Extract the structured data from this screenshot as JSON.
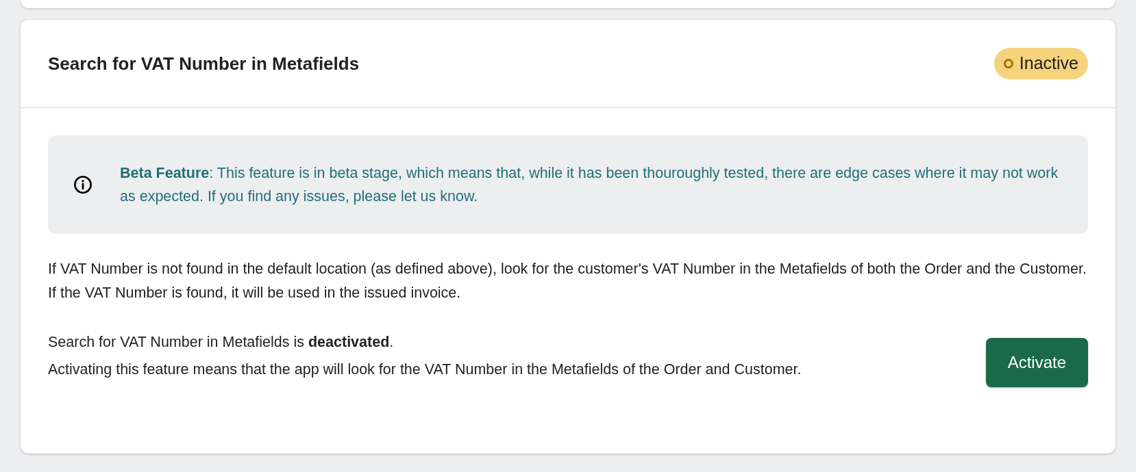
{
  "card": {
    "title": "Search for VAT Number in Metafields",
    "status": {
      "label": "Inactive",
      "kind": "inactive"
    },
    "banner": {
      "text": "**Beta Feature**: This feature is in beta stage, which means that, while it has been thouroughly tested, there are edge cases where it may not work as expected. If you find any issues, please let us know."
    },
    "description": "If VAT Number is not found in the default location (as defined above), look for the customer's VAT Number in the Metafields of both the Order and the Customer. If the VAT Number is found, it will be used in the issued invoice.",
    "state_line": "Search for VAT Number in Metafields is **deactivated**.",
    "explanation": "Activating this feature means that the app will look for the VAT Number in the Metafields of the Order and Customer.",
    "button": "Activate"
  }
}
